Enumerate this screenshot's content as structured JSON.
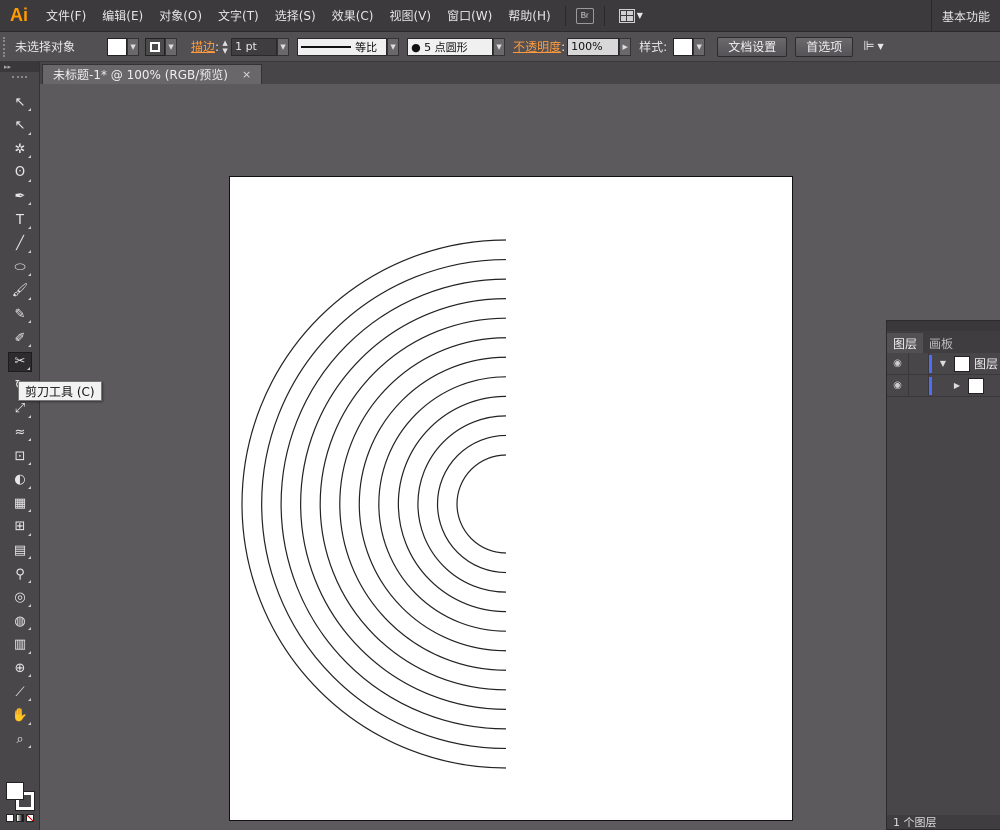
{
  "app": {
    "logo": "Ai"
  },
  "menu": {
    "items": [
      "文件(F)",
      "编辑(E)",
      "对象(O)",
      "文字(T)",
      "选择(S)",
      "效果(C)",
      "视图(V)",
      "窗口(W)",
      "帮助(H)"
    ],
    "bridge_label": "Br",
    "workspace": "基本功能"
  },
  "control": {
    "selection_status": "未选择对象",
    "stroke_label": "描边",
    "stroke_weight": "1 pt",
    "stroke_profile": "等比",
    "brush": "● 5 点圆形",
    "opacity_label": "不透明度",
    "opacity_value": "100%",
    "style_label": "样式:",
    "doc_setup": "文档设置",
    "preferences": "首选项"
  },
  "document": {
    "tab_title": "未标题-1* @ 100% (RGB/预览)",
    "tab_close": "×"
  },
  "tooltip": {
    "text": "剪刀工具 (C)"
  },
  "tools": [
    {
      "name": "selection-tool",
      "glyph": "↖"
    },
    {
      "name": "direct-selection-tool",
      "glyph": "↖"
    },
    {
      "name": "magic-wand-tool",
      "glyph": "✲"
    },
    {
      "name": "lasso-tool",
      "glyph": "ʘ"
    },
    {
      "name": "pen-tool",
      "glyph": "✒"
    },
    {
      "name": "type-tool",
      "glyph": "T"
    },
    {
      "name": "line-tool",
      "glyph": "╱"
    },
    {
      "name": "ellipse-tool",
      "glyph": "⬭"
    },
    {
      "name": "paintbrush-tool",
      "glyph": "🖌"
    },
    {
      "name": "pencil-tool",
      "glyph": "✎"
    },
    {
      "name": "blob-brush-tool",
      "glyph": "✐"
    },
    {
      "name": "scissors-tool",
      "glyph": "✂"
    },
    {
      "name": "rotate-tool",
      "glyph": "↻"
    },
    {
      "name": "scale-tool",
      "glyph": "⤢"
    },
    {
      "name": "warp-tool",
      "glyph": "≈"
    },
    {
      "name": "free-transform-tool",
      "glyph": "⊡"
    },
    {
      "name": "shape-builder-tool",
      "glyph": "◐"
    },
    {
      "name": "perspective-grid-tool",
      "glyph": "▦"
    },
    {
      "name": "mesh-tool",
      "glyph": "⊞"
    },
    {
      "name": "gradient-tool",
      "glyph": "▤"
    },
    {
      "name": "eyedropper-tool",
      "glyph": "⚲"
    },
    {
      "name": "blend-tool",
      "glyph": "◎"
    },
    {
      "name": "symbol-sprayer-tool",
      "glyph": "◍"
    },
    {
      "name": "column-graph-tool",
      "glyph": "▥"
    },
    {
      "name": "artboard-tool",
      "glyph": "⊕"
    },
    {
      "name": "slice-tool",
      "glyph": "⟋"
    },
    {
      "name": "hand-tool",
      "glyph": "✋"
    },
    {
      "name": "zoom-tool",
      "glyph": "⌕"
    }
  ],
  "artwork": {
    "semicircle_count": 12,
    "stroke_color": "#222222"
  },
  "layers_panel": {
    "tabs": [
      "图层",
      "画板"
    ],
    "rows": [
      {
        "name": "图层"
      },
      {
        "name": ""
      }
    ],
    "status": "1 个图层"
  },
  "colors": {
    "accent_orange": "#ff9b3d",
    "logo_orange": "#ff9a00",
    "layer_color": "#4f6ef7"
  }
}
